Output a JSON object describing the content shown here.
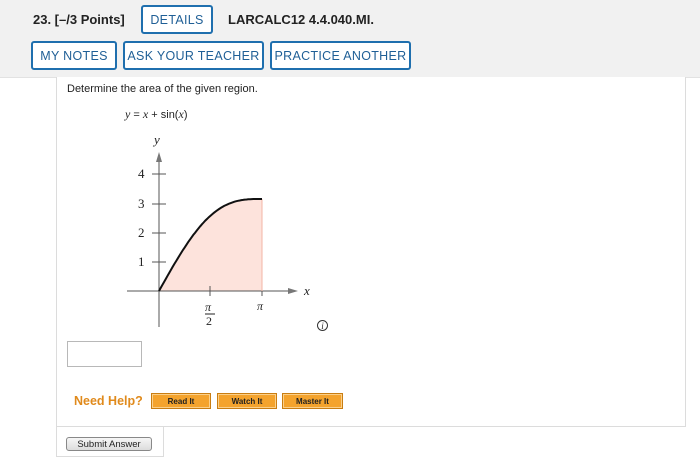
{
  "question": {
    "number_points": "23.  [–/3 Points]",
    "code": "LARCALC12 4.4.040.MI."
  },
  "toolbar": {
    "details_label": "DETAILS",
    "my_notes_label": "MY NOTES",
    "ask_teacher_label": "ASK YOUR TEACHER",
    "practice_label": "PRACTICE ANOTHER"
  },
  "problem": {
    "prompt": "Determine the area of the given region.",
    "equation_lhs": "y",
    "equation_rhs_a": "x",
    "equation_rhs_b": "sin(",
    "equation_rhs_c": "x",
    "equation_rhs_d": ")"
  },
  "graph": {
    "y_axis_label": "y",
    "x_axis_label": "x",
    "y_ticks": [
      "1",
      "2",
      "3",
      "4"
    ],
    "x_tick_pi_half_num": "π",
    "x_tick_pi_half_den": "2",
    "x_tick_pi": "π",
    "fill_color": "#fde3dc",
    "curve_color": "#111111"
  },
  "answer": {
    "value": ""
  },
  "help": {
    "need_help_label": "Need Help?",
    "read_label": "Read It",
    "watch_label": "Watch It",
    "master_label": "Master It"
  },
  "submit": {
    "label": "Submit Answer"
  },
  "icons": {
    "info": "info-icon"
  }
}
